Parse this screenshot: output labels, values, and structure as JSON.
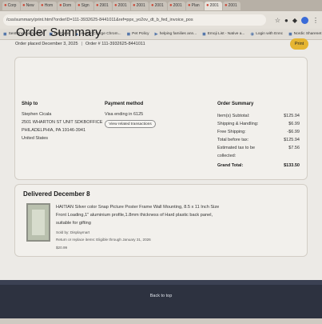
{
  "browser": {
    "tabs": [
      "Corp",
      "New",
      "Hom",
      "Dom",
      "Sign",
      "2901",
      "2001",
      "2001",
      "2001",
      "2001",
      "Plan",
      "2001",
      "2001"
    ],
    "url": "/css/summary/print.html?orderID=111-3932625-8441011&ref=ppx_yo2ov_dt_b_fed_invoice_pos",
    "bookmarks": [
      "SentOne Dashboard",
      "CellGate",
      "Avatar Charge Chrom...",
      "Pet Policy",
      "helping families ann...",
      "Emoji List - Native a...",
      "Login with Ennc",
      "Nordic Sharenet"
    ]
  },
  "header": {
    "title": "Order Summary",
    "order_placed": "Order placed December 3, 2025",
    "order_number": "Order # 111-3932625-8441011",
    "print_label": "Print"
  },
  "ship_to": {
    "heading": "Ship to",
    "lines": [
      "Stephen Cicala",
      "2501 WHARTON ST UNIT SDKBOFFICE",
      "PHILADELPHIA, PA 19146-3941",
      "United States"
    ]
  },
  "payment": {
    "heading": "Payment method",
    "card": "Visa  ending in 6125",
    "view_label": "View related transactions"
  },
  "order_summary": {
    "heading": "Order Summary",
    "rows": [
      {
        "label": "Item(s) Subtotal:",
        "value": "$125.94"
      },
      {
        "label": "Shipping & Handling:",
        "value": "$6.99"
      },
      {
        "label": "Free Shipping:",
        "value": "-$6.99"
      },
      {
        "label": "Total before tax:",
        "value": "$125.94"
      },
      {
        "label": "Estimated tax to be",
        "value": "$7.56"
      },
      {
        "label": "collected:",
        "value": ""
      },
      {
        "label": "Grand Total:",
        "value": "$133.50"
      }
    ]
  },
  "delivery": {
    "heading": "Delivered December 8",
    "item_lines": [
      "HAITIAN Silver color Snap Picture Poster Frame Wall Mounting, 8.5 x 11 Inch Size",
      "Front Loading,1\" aluminium profile,1.8mm thickness of Hard plastic back panel,",
      "suitable for gifting"
    ],
    "sold_by": "Sold by: Displaymart",
    "return_note": "Return or replace items: Eligible through January 31, 2026",
    "price": "$20.99"
  },
  "footer": {
    "back_to_top": "Back to top"
  }
}
